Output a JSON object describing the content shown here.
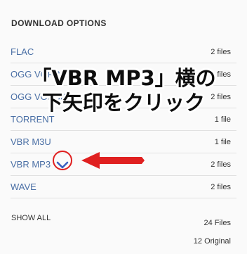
{
  "panel": {
    "heading": "DOWNLOAD OPTIONS",
    "options": [
      {
        "label": "FLAC",
        "count": "2 files"
      },
      {
        "label": "OGG VORBIS",
        "count": "2 files"
      },
      {
        "label": "OGG VORBIS",
        "count": "2 files"
      },
      {
        "label": "TORRENT",
        "count": "1 file"
      },
      {
        "label": "VBR M3U",
        "count": "1 file"
      },
      {
        "label": "VBR MP3",
        "count": "2 files"
      },
      {
        "label": "WAVE",
        "count": "2 files"
      }
    ],
    "show_all": "SHOW ALL",
    "total_files": "24 Files",
    "total_original": "12 Original"
  },
  "overlay": {
    "line1": "「VBR MP3」横の",
    "line2": "下矢印をクリック"
  },
  "colors": {
    "link": "#4a6fa5",
    "annotation_red": "#e02020",
    "download_arrow": "#3b5fc0"
  },
  "icons": {
    "download": "chevron-down-icon",
    "pointer": "arrow-left-icon"
  }
}
